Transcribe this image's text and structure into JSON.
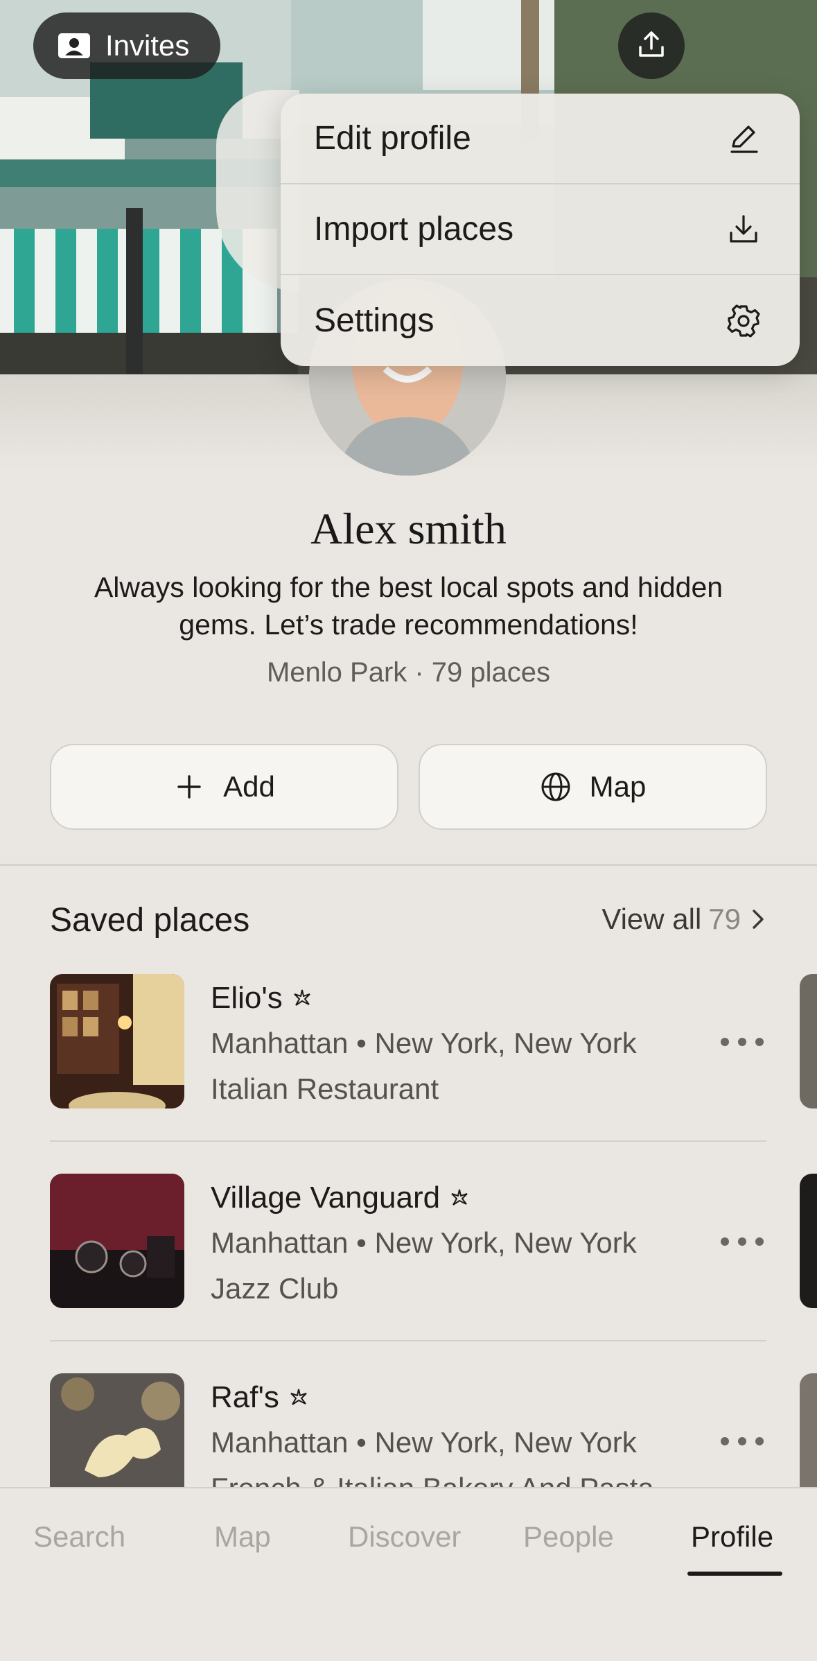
{
  "header": {
    "invites_label": "Invites"
  },
  "menu": {
    "items": [
      {
        "label": "Edit profile",
        "icon": "pencil-icon"
      },
      {
        "label": "Import places",
        "icon": "download-icon"
      },
      {
        "label": "Settings",
        "icon": "gear-icon"
      }
    ]
  },
  "profile": {
    "name": "Alex smith",
    "bio": "Always looking for the best local spots and hidden gems. Let’s trade recommendations!",
    "meta": "Menlo Park · 79 places"
  },
  "actions": {
    "add_label": "Add",
    "map_label": "Map"
  },
  "saved": {
    "title": "Saved places",
    "view_all_label": "View all",
    "view_all_count": "79",
    "places": [
      {
        "name": "Elio's",
        "location": "Manhattan • New York, New York",
        "type": "Italian Restaurant"
      },
      {
        "name": "Village Vanguard",
        "location": "Manhattan • New York, New York",
        "type": "Jazz Club"
      },
      {
        "name": "Raf's",
        "location": "Manhattan • New York, New York",
        "type": "French & Italian Bakery And Pasta"
      }
    ]
  },
  "tabs": [
    {
      "label": "Search"
    },
    {
      "label": "Map"
    },
    {
      "label": "Discover"
    },
    {
      "label": "People"
    },
    {
      "label": "Profile",
      "active": true
    }
  ],
  "colors": {
    "background": "#eae7e2",
    "text_primary": "#1c1b1a",
    "text_secondary": "#55524e",
    "tab_inactive": "#a9a6a1"
  }
}
